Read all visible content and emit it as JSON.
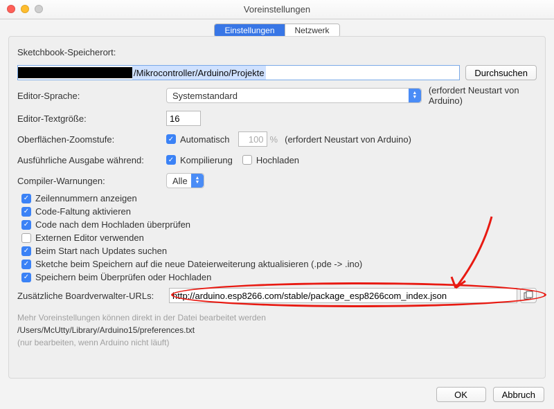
{
  "window": {
    "title": "Voreinstellungen"
  },
  "tabs": {
    "settings": "Einstellungen",
    "network": "Netzwerk"
  },
  "sketchbook": {
    "label": "Sketchbook-Speicherort:",
    "path_visible": "/Mikrocontroller/Arduino/Projekte",
    "browse": "Durchsuchen"
  },
  "editor_lang": {
    "label": "Editor-Sprache:",
    "value": "Systemstandard",
    "hint": "(erfordert Neustart von Arduino)"
  },
  "editor_size": {
    "label": "Editor-Textgröße:",
    "value": "16"
  },
  "zoom": {
    "label": "Oberflächen-Zoomstufe:",
    "auto_label": "Automatisch",
    "value": "100",
    "percent": "%",
    "hint": "(erfordert Neustart von Arduino)"
  },
  "verbose": {
    "label": "Ausführliche Ausgabe während:",
    "compile": "Kompilierung",
    "upload": "Hochladen"
  },
  "compiler_warn": {
    "label": "Compiler-Warnungen:",
    "value": "Alle"
  },
  "checks": {
    "linenum": "Zeilennummern anzeigen",
    "codefold": "Code-Faltung aktivieren",
    "verify_upload": "Code nach dem Hochladen überprüfen",
    "ext_editor": "Externen Editor verwenden",
    "check_updates": "Beim Start nach Updates suchen",
    "update_ext": "Sketche beim Speichern auf die neue Dateierweiterung aktualisieren (.pde -> .ino)",
    "save_verify": "Speichern beim Überprüfen oder Hochladen"
  },
  "boards_url": {
    "label": "Zusätzliche Boardverwalter-URLs:",
    "value": "http://arduino.esp8266.com/stable/package_esp8266com_index.json"
  },
  "info": {
    "line1": "Mehr Voreinstellungen können direkt in der Datei bearbeitet werden",
    "path": "/Users/McUtty/Library/Arduino15/preferences.txt",
    "line2": "(nur bearbeiten, wenn Arduino nicht läuft)"
  },
  "buttons": {
    "ok": "OK",
    "cancel": "Abbruch"
  }
}
